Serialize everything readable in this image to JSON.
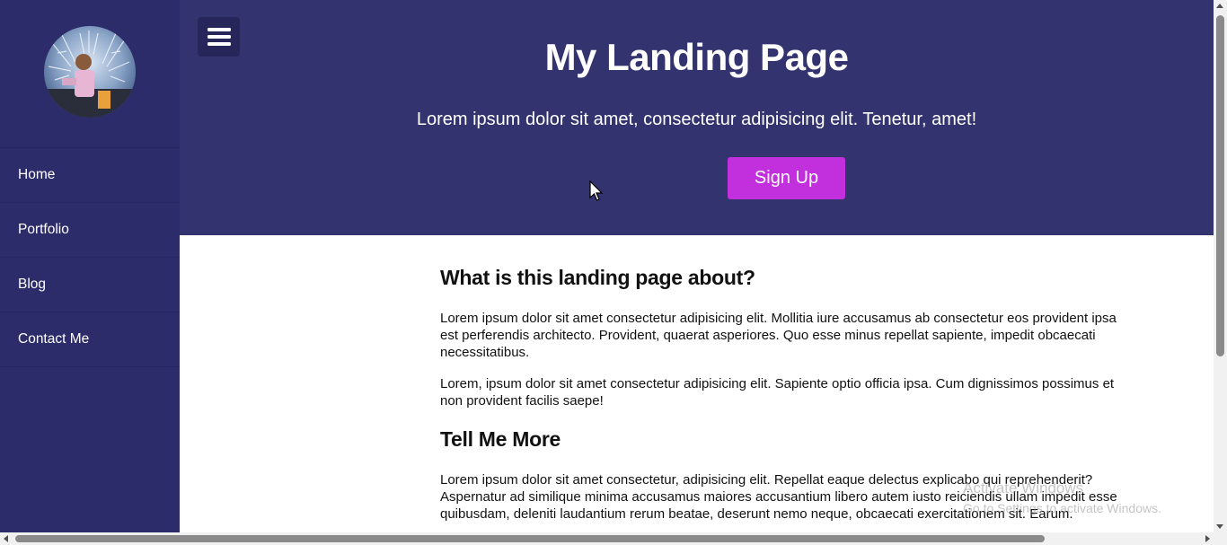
{
  "sidebar": {
    "avatar_icon": "profile-photo",
    "items": [
      {
        "label": "Home"
      },
      {
        "label": "Portfolio"
      },
      {
        "label": "Blog"
      },
      {
        "label": "Contact Me"
      }
    ]
  },
  "header": {
    "menu_icon": "hamburger-icon",
    "title": "My Landing Page",
    "subtitle": "Lorem ipsum dolor sit amet, consectetur adipisicing elit. Tenetur, amet!",
    "signup_label": "Sign Up"
  },
  "main": {
    "heading1": "What is this landing page about?",
    "para1": "Lorem ipsum dolor sit amet consectetur adipisicing elit. Mollitia iure accusamus ab consectetur eos provident ipsa est perferendis architecto. Provident, quaerat asperiores. Quo esse minus repellat sapiente, impedit obcaecati necessitatibus.",
    "para2": "Lorem, ipsum dolor sit amet consectetur adipisicing elit. Sapiente optio officia ipsa. Cum dignissimos possimus et non provident facilis saepe!",
    "heading2": "Tell Me More",
    "para3": "Lorem ipsum dolor sit amet consectetur, adipisicing elit. Repellat eaque delectus explicabo qui reprehenderit? Aspernatur ad similique minima accusamus maiores accusantium libero autem iusto reiciendis ullam impedit esse quibusdam, deleniti laudantium rerum beatae, deserunt nemo neque, obcaecati exercitationem sit. Earum."
  },
  "watermark": {
    "line1": "Activate Windows",
    "line2": "Go to Settings to activate Windows."
  },
  "colors": {
    "sidebar_bg": "#2c2c6b",
    "header_bg": "#33336f",
    "accent": "#c22fdc"
  }
}
